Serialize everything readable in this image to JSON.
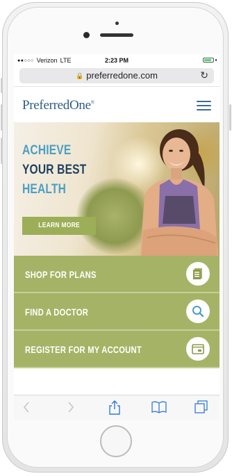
{
  "status": {
    "carrier": "Verizon",
    "network": "LTE",
    "time": "2:23 PM",
    "battery_level": 0.85
  },
  "browser": {
    "url": "preferredone.com"
  },
  "site": {
    "logo_text": "PreferredOne",
    "hero": {
      "line1": "ACHIEVE",
      "line2": "YOUR BEST",
      "line3": "HEALTH",
      "cta": "LEARN MORE"
    },
    "menu": [
      {
        "label": "SHOP FOR PLANS",
        "icon": "document-icon"
      },
      {
        "label": "FIND A DOCTOR",
        "icon": "search-icon"
      },
      {
        "label": "REGISTER FOR MY ACCOUNT",
        "icon": "window-icon"
      }
    ]
  },
  "colors": {
    "brand_blue": "#2f5d86",
    "accent_blue": "#4c9fc3",
    "olive_green": "#a5b366"
  }
}
